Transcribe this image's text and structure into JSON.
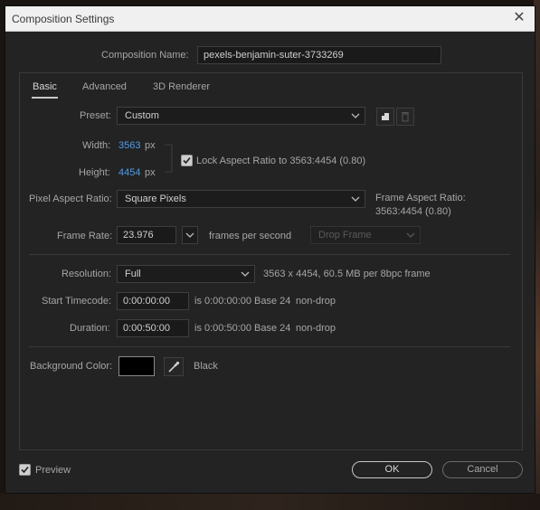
{
  "window": {
    "title": "Composition Settings",
    "close_label": "✕"
  },
  "composition_name": {
    "label": "Composition Name:",
    "value": "pexels-benjamin-suter-3733269"
  },
  "tabs": [
    {
      "label": "Basic",
      "active": true
    },
    {
      "label": "Advanced",
      "active": false
    },
    {
      "label": "3D Renderer",
      "active": false
    }
  ],
  "preset": {
    "label": "Preset:",
    "value": "Custom"
  },
  "width": {
    "label": "Width:",
    "value": "3563",
    "unit": "px"
  },
  "height": {
    "label": "Height:",
    "value": "4454",
    "unit": "px"
  },
  "lock_aspect": {
    "label": "Lock Aspect Ratio to 3563:4454 (0.80)",
    "checked": true
  },
  "pixel_aspect": {
    "label": "Pixel Aspect Ratio:",
    "value": "Square Pixels"
  },
  "frame_aspect": {
    "label": "Frame Aspect Ratio:",
    "value": "3563:4454 (0.80)"
  },
  "frame_rate": {
    "label": "Frame Rate:",
    "value": "23.976",
    "unit": "frames per second",
    "drop_frame": "Drop Frame"
  },
  "resolution": {
    "label": "Resolution:",
    "value": "Full",
    "info": "3563 x 4454, 60.5 MB per 8bpc frame"
  },
  "start_timecode": {
    "label": "Start Timecode:",
    "value": "0:00:00:00",
    "is": "is 0:00:00:00",
    "base": "Base 24",
    "mode": "non-drop"
  },
  "duration": {
    "label": "Duration:",
    "value": "0:00:50:00",
    "is": "is 0:00:50:00",
    "base": "Base 24",
    "mode": "non-drop"
  },
  "background": {
    "label": "Background Color:",
    "color_name": "Black",
    "color": "#000000"
  },
  "preview": {
    "label": "Preview",
    "checked": true
  },
  "buttons": {
    "ok": "OK",
    "cancel": "Cancel"
  },
  "colors": {
    "accent": "#4b9cf0",
    "panel_bg": "#232323"
  }
}
